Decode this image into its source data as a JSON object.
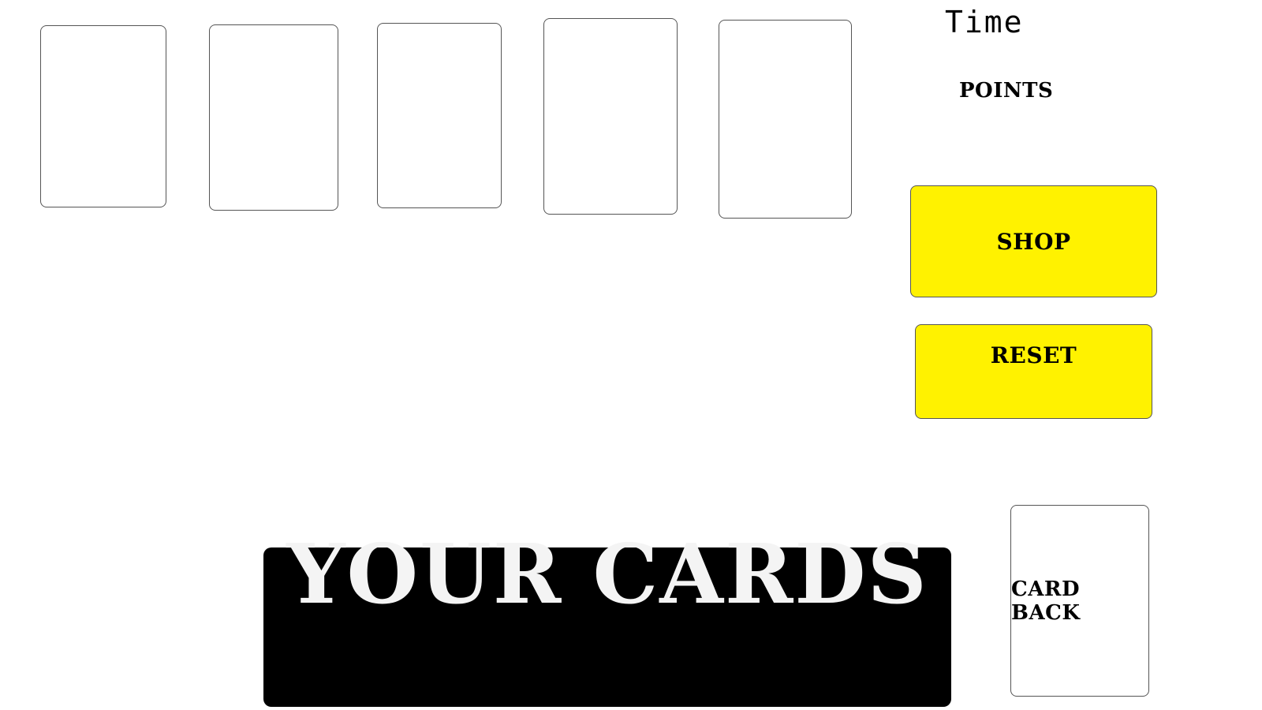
{
  "hud": {
    "time_label": "Time",
    "points_label": "POINTS"
  },
  "table": {
    "card_slots": [
      "",
      "",
      "",
      "",
      ""
    ]
  },
  "controls": {
    "shop_label": "SHOP",
    "reset_label": "RESET"
  },
  "hand": {
    "title": "YOUR CARDS"
  },
  "deck": {
    "card_back_label": "CARD BACK"
  },
  "colors": {
    "button_yellow": "#fff200",
    "hand_background": "#000000",
    "hand_title": "#f4f4f4",
    "card_border": "#555555"
  }
}
